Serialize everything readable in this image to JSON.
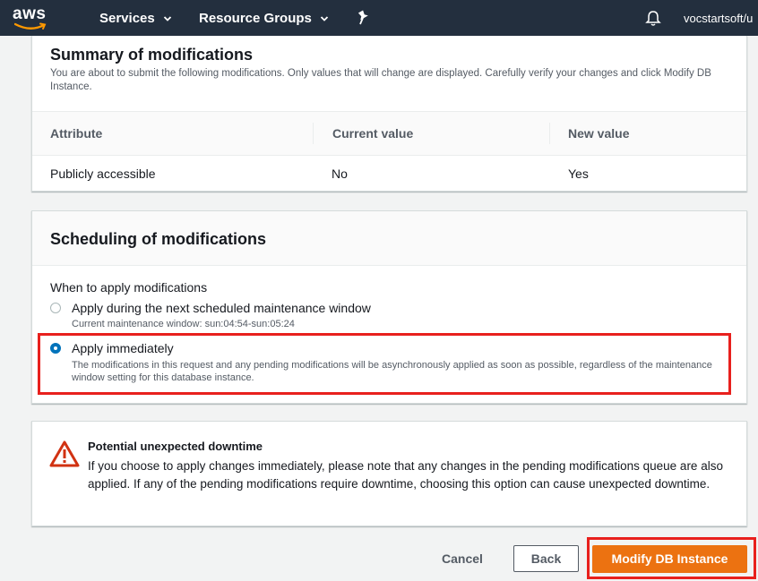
{
  "nav": {
    "logo": "aws",
    "services": "Services",
    "resource_groups": "Resource Groups",
    "account": "vocstartsoft/u"
  },
  "summary": {
    "title": "Summary of modifications",
    "description": "You are about to submit the following modifications. Only values that will change are displayed. Carefully verify your changes and click Modify DB Instance.",
    "columns": [
      "Attribute",
      "Current value",
      "New value"
    ],
    "rows": [
      [
        "Publicly accessible",
        "No",
        "Yes"
      ]
    ]
  },
  "scheduling": {
    "title": "Scheduling of modifications",
    "when_label": "When to apply modifications",
    "options": [
      {
        "label": "Apply during the next scheduled maintenance window",
        "description": "Current maintenance window: sun:04:54-sun:05:24",
        "selected": false
      },
      {
        "label": "Apply immediately",
        "description": "The modifications in this request and any pending modifications will be asynchronously applied as soon as possible, regardless of the maintenance window setting for this database instance.",
        "selected": true
      }
    ]
  },
  "warning": {
    "title": "Potential unexpected downtime",
    "text": "If you choose to apply changes immediately, please note that any changes in the pending modifications queue are also applied. If any of the pending modifications require downtime, choosing this option can cause unexpected downtime."
  },
  "footer": {
    "cancel": "Cancel",
    "back": "Back",
    "modify": "Modify DB Instance"
  },
  "colors": {
    "nav_bg": "#232f3e",
    "primary_button": "#ec7211",
    "selected_radio": "#0073bb",
    "warning_icon": "#d13212",
    "highlight_border": "#e8201d"
  },
  "icons": [
    "aws-logo",
    "chevron-down-icon",
    "pin-icon",
    "bell-icon",
    "warning-icon"
  ]
}
